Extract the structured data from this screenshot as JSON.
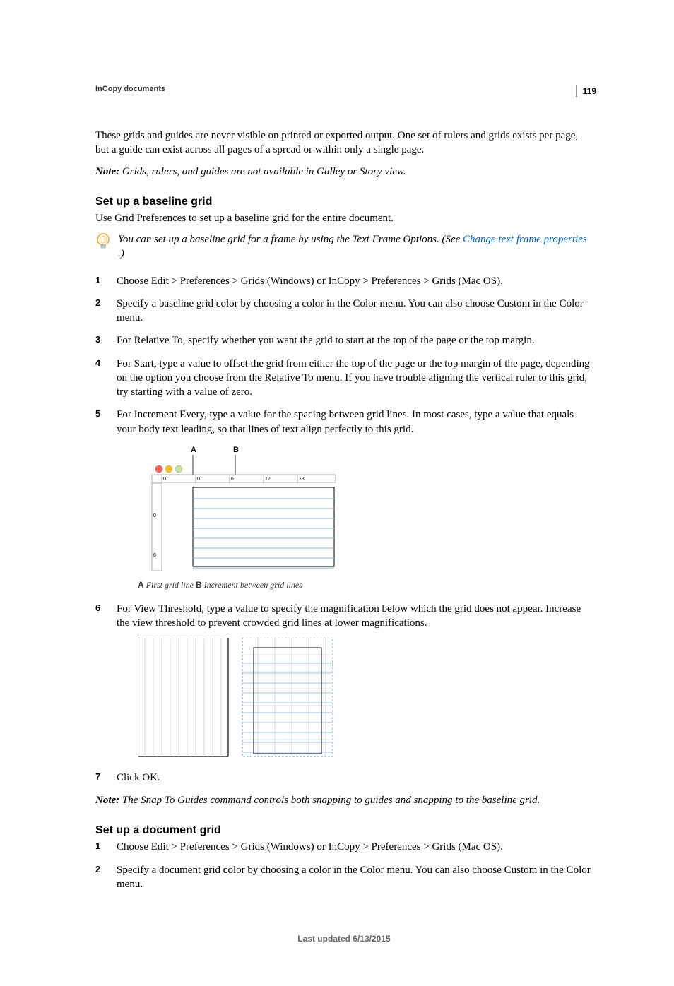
{
  "page_number": "119",
  "chapter": "InCopy documents",
  "intro_paragraph": "These grids and guides are never visible on printed or exported output. One set of rulers and grids exists per page, but a guide can exist across all pages of a spread or within only a single page.",
  "note1_label": "Note:",
  "note1_text": " Grids, rulers, and guides are not available in Galley or Story view.",
  "section1_heading": "Set up a baseline grid",
  "section1_intro": "Use Grid Preferences to set up a baseline grid for the entire document.",
  "tip_text_prefix": "You can set up a baseline grid for a frame by using the Text Frame Options. (See ",
  "tip_link": "Change text frame properties",
  "tip_text_suffix": " .)",
  "steps1": {
    "s1": "Choose Edit > Preferences > Grids (Windows) or InCopy > Preferences > Grids (Mac OS).",
    "s2": "Specify a baseline grid color by choosing a color in the Color menu. You can also choose Custom in the Color menu.",
    "s3": "For Relative To, specify whether you want the grid to start at the top of the page or the top margin.",
    "s4": "For Start, type a value to offset the grid from either the top of the page or the top margin of the page, depending on the option you choose from the Relative To menu. If you have trouble aligning the vertical ruler to this grid, try starting with a value of zero.",
    "s5": "For Increment Every, type a value for the spacing between grid lines. In most cases, type a value that equals your body text leading, so that lines of text align perfectly to this grid.",
    "s6": "For View Threshold, type a value to specify the magnification below which the grid does not appear. Increase the view threshold to prevent crowded grid lines at lower magnifications.",
    "s7": "Click OK."
  },
  "fig1_caption_a_letter": "A",
  "fig1_caption_a_text": " First grid line ",
  "fig1_caption_b_letter": "B",
  "fig1_caption_b_text": " Increment between grid lines",
  "fig1_labelA": "A",
  "fig1_labelB": "B",
  "fig1_ruler0a": "0",
  "fig1_ruler0b": "0",
  "fig1_ruler6": "6",
  "fig1_ruler12": "12",
  "fig1_ruler18": "18",
  "fig1_ruler_v0": "0",
  "fig1_ruler_v6": "6",
  "note2_label": "Note:",
  "note2_text": " The Snap To Guides command controls both snapping to guides and snapping to the baseline grid.",
  "section2_heading": "Set up a document grid",
  "steps2": {
    "s1": "Choose Edit > Preferences > Grids (Windows) or InCopy > Preferences > Grids (Mac OS).",
    "s2": "Specify a document grid color by choosing a color in the Color menu. You can also choose Custom in the Color menu."
  },
  "footer_text": "Last updated 6/13/2015"
}
